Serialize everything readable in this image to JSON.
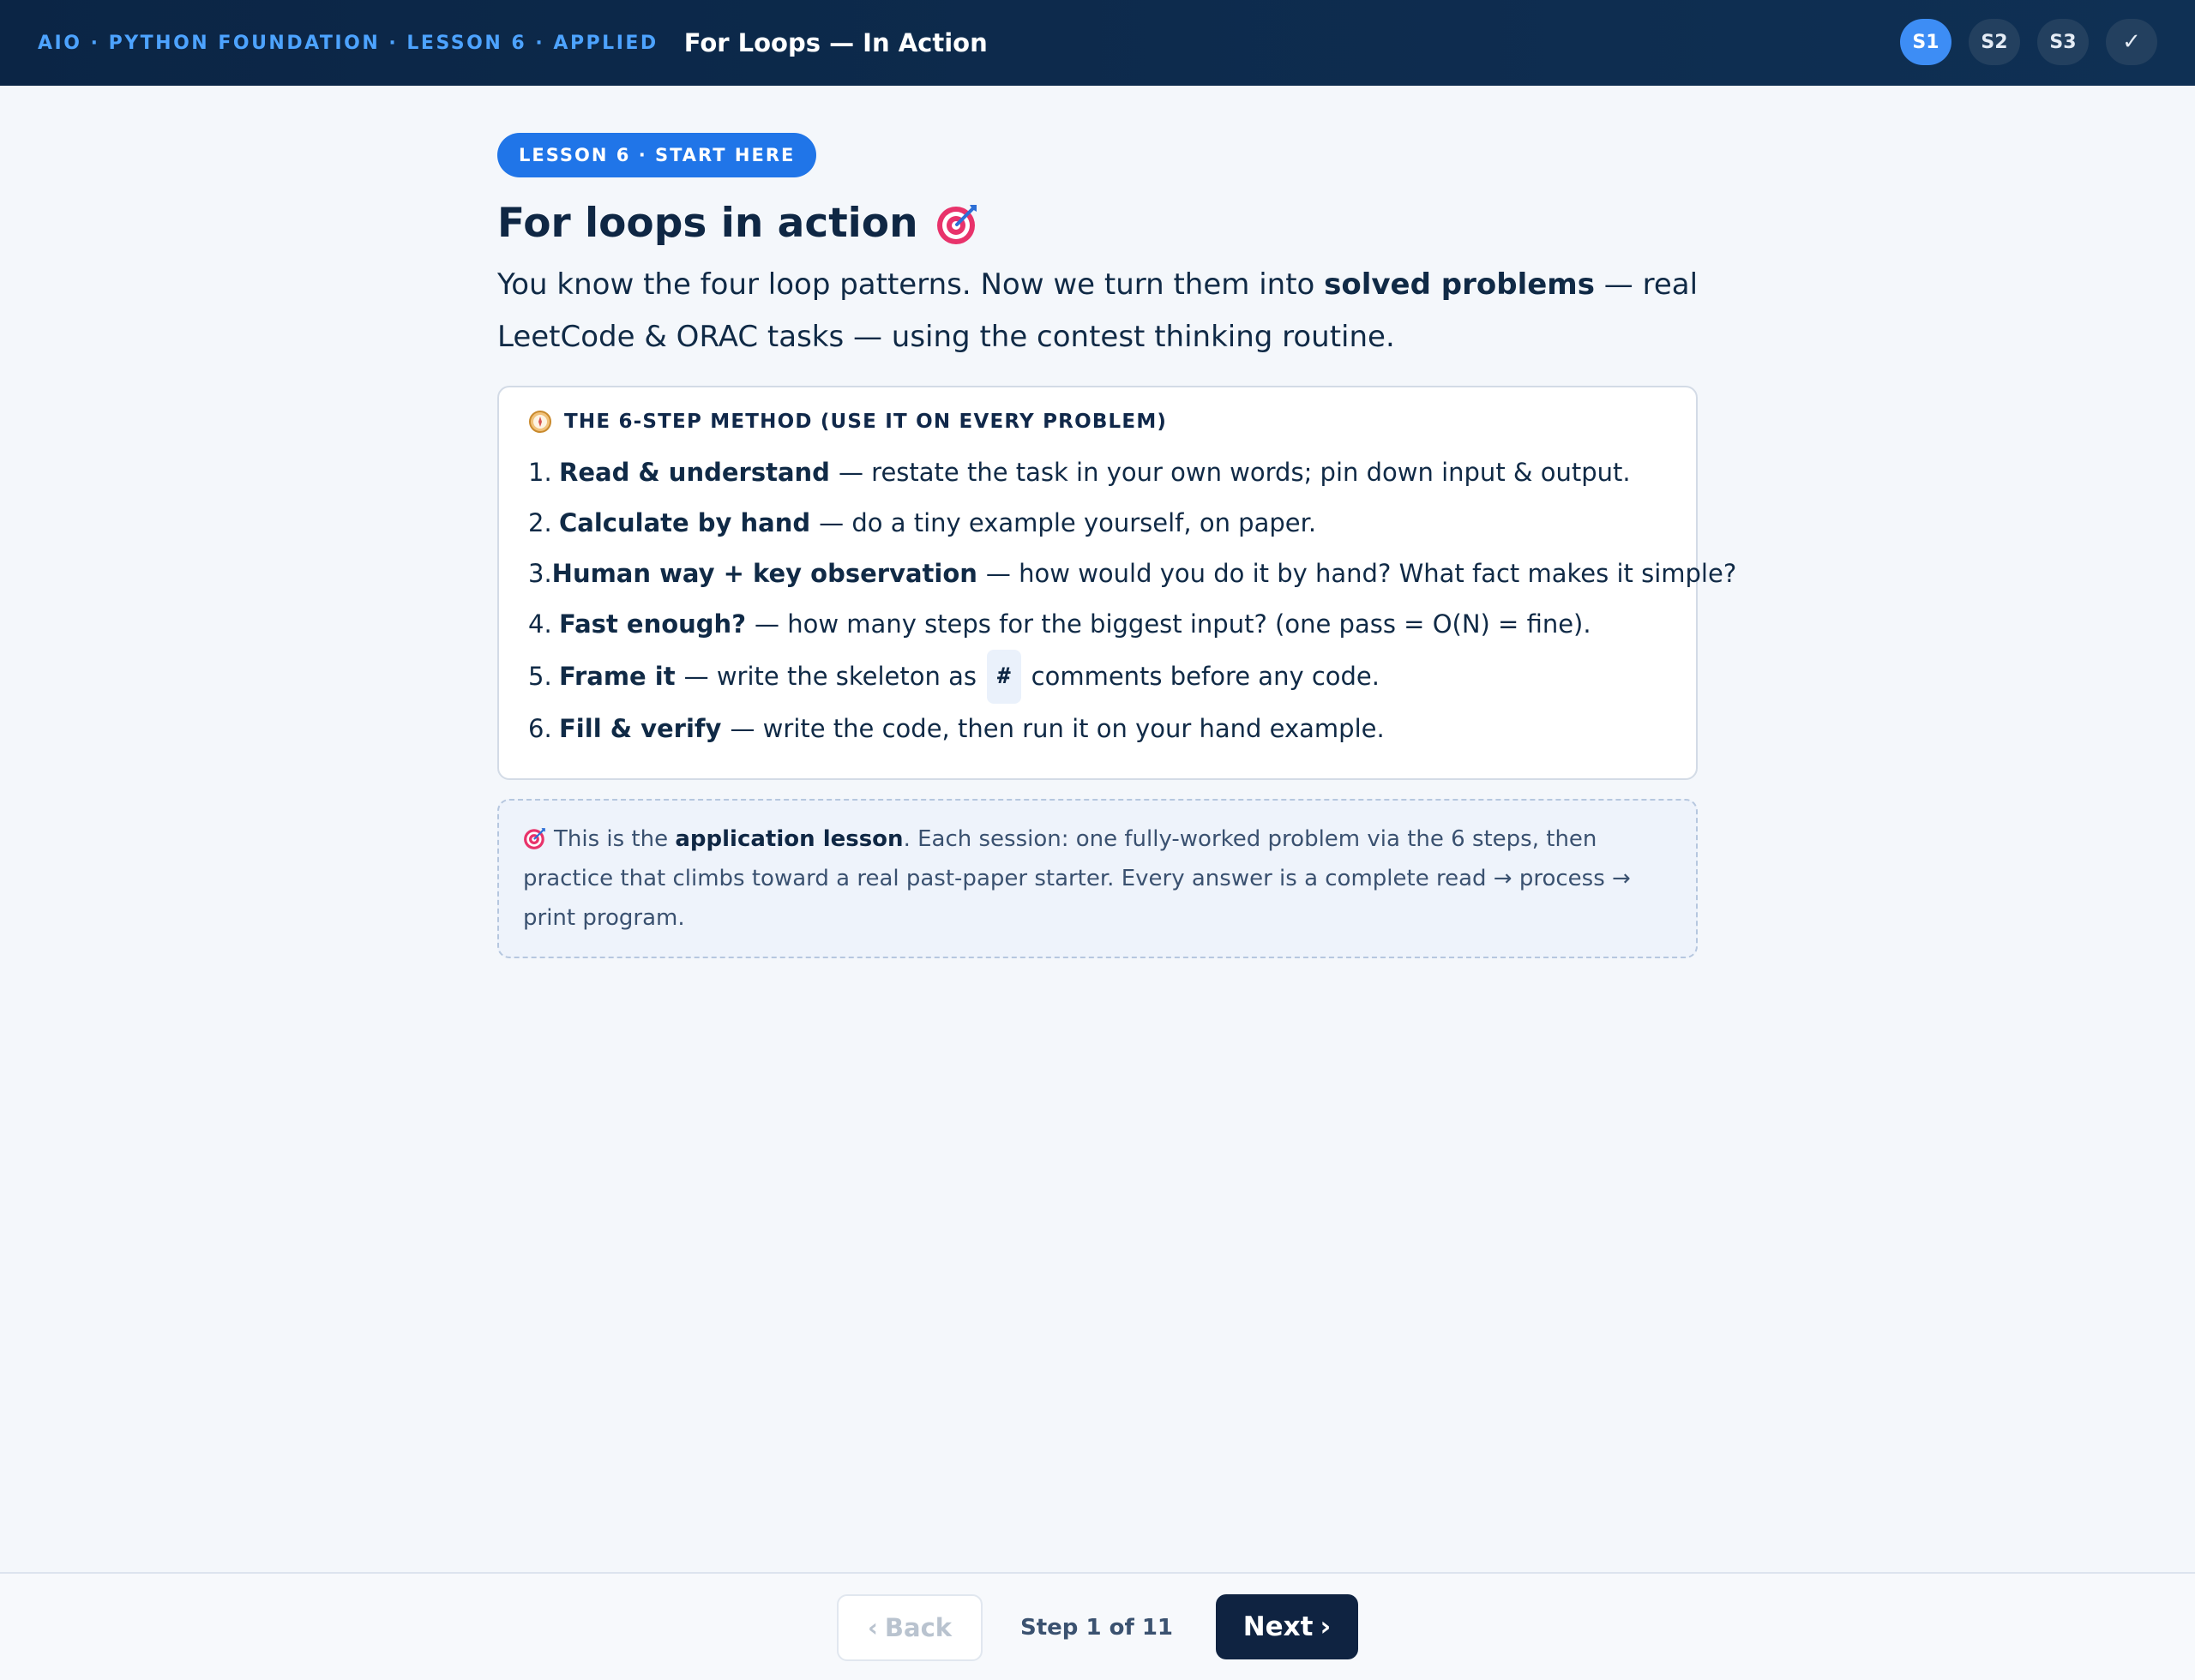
{
  "header": {
    "breadcrumb": "AIO · PYTHON FOUNDATION · LESSON 6 · APPLIED",
    "title": "For Loops — In Action",
    "steps": [
      {
        "label": "S1",
        "active": true
      },
      {
        "label": "S2",
        "active": false
      },
      {
        "label": "S3",
        "active": false
      },
      {
        "label": "✓",
        "active": false
      }
    ]
  },
  "main": {
    "badge": "LESSON 6 · START HERE",
    "title": "For loops in action",
    "title_icon": "target-icon",
    "intro": {
      "before": "You know the four loop patterns. Now we turn them into ",
      "bold": "solved problems",
      "after": " — real LeetCode & ORAC tasks — using the contest thinking routine."
    },
    "method": {
      "icon": "compass-icon",
      "heading": "THE 6-STEP METHOD (USE IT ON EVERY PROBLEM)",
      "items": [
        {
          "num": "1.",
          "bold": "Read & understand",
          "text": "— restate the task in your own words; pin down input & output."
        },
        {
          "num": "2.",
          "bold": "Calculate by hand",
          "text": "— do a tiny example yourself, on paper."
        },
        {
          "num": "3.",
          "bold": "Human way + key observation",
          "text": "— how would you do it by hand? What fact makes it simple?"
        },
        {
          "num": "4.",
          "bold": "Fast enough?",
          "text": "— how many steps for the biggest input? (one pass = O(N) = fine)."
        },
        {
          "num": "5.",
          "bold": "Frame it",
          "text": "— write the skeleton as",
          "code": "#",
          "text_after": "comments before any code."
        },
        {
          "num": "6.",
          "bold": "Fill & verify",
          "text": "— write the code, then run it on your hand example."
        }
      ]
    },
    "note": {
      "icon": "target-icon",
      "before": "This is the ",
      "bold": "application lesson",
      "after": ". Each session: one fully-worked problem via the 6 steps, then practice that climbs toward a real past-paper starter. Every answer is a complete read → process → print program."
    }
  },
  "footer": {
    "back_label": "Back",
    "back_chevron": "‹",
    "step_text": "Step 1 of 11",
    "next_label": "Next",
    "next_chevron": "›"
  },
  "colors": {
    "header_bg": "#0b2545",
    "accent": "#2075e8",
    "active_step": "#3d8df5",
    "next_button": "#0f2341"
  }
}
